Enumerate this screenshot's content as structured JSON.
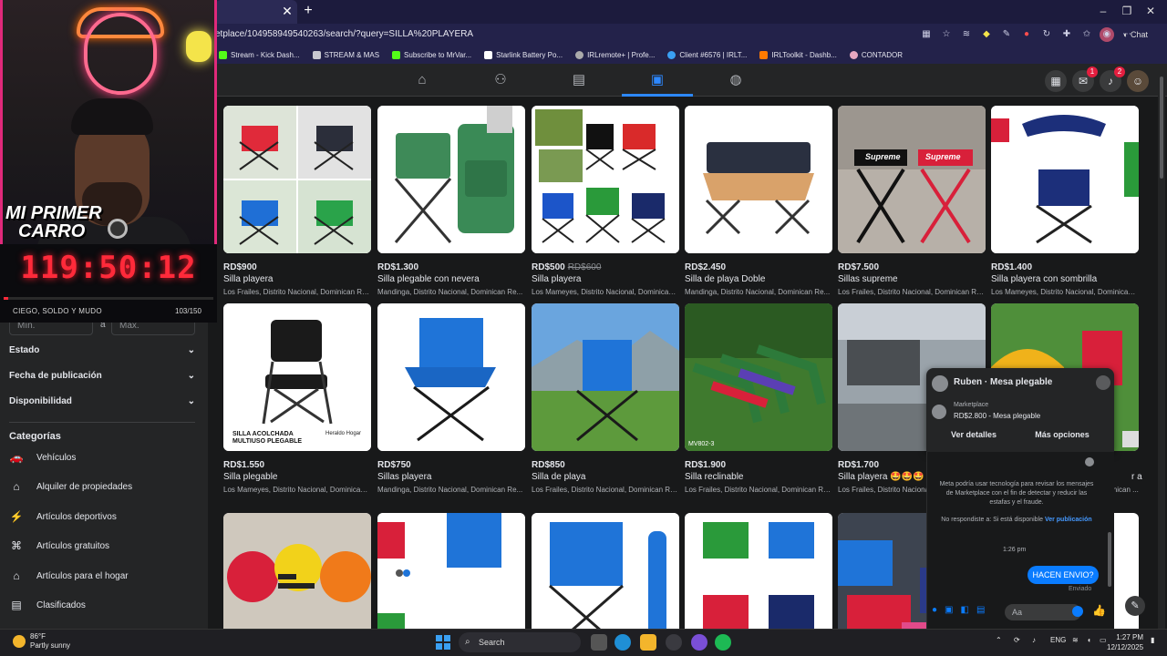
{
  "browser": {
    "url": "etplace/104958949540263/search/?query=SILLA%20PLAYERA",
    "bookmarks": [
      {
        "label": "Stream - Kick Dash..."
      },
      {
        "label": "STREAM & MAS"
      },
      {
        "label": "Subscribe to MrVar..."
      },
      {
        "label": "Starlink Battery Po..."
      },
      {
        "label": "IRLremote+ | Profe..."
      },
      {
        "label": "Client #6576 | IRLT..."
      },
      {
        "label": "IRLToolkit - Dashb..."
      },
      {
        "label": "CONTADOR"
      }
    ],
    "copilot_label": "Chat"
  },
  "facebook": {
    "badges": {
      "messenger": "1",
      "notifications": "2"
    }
  },
  "sidebar": {
    "min_placeholder": "Mín.",
    "max_placeholder": "Máx.",
    "range_sep": "a",
    "filters": [
      "Estado",
      "Fecha de publicación",
      "Disponibilidad"
    ],
    "categories_title": "Categorías",
    "categories": [
      {
        "label": "Vehículos",
        "icon": "car-icon"
      },
      {
        "label": "Alquiler de propiedades",
        "icon": "house-icon"
      },
      {
        "label": "Artículos deportivos",
        "icon": "running-icon"
      },
      {
        "label": "Artículos gratuitos",
        "icon": "tag-icon"
      },
      {
        "label": "Artículos para el hogar",
        "icon": "home-icon"
      },
      {
        "label": "Clasificados",
        "icon": "clipboard-icon"
      }
    ]
  },
  "stream_overlay": {
    "logo_line1": "MI PRIMER",
    "logo_line2": "CARRO",
    "timer": "119:50:12",
    "label": "CIEGO, SOLDO Y MUDO",
    "count": "103/150",
    "progress": 0.02
  },
  "listings": [
    {
      "price": "RD$900",
      "old_price": "",
      "title": "Silla playera",
      "location": "Los Frailes, Distrito Nacional, Dominican Re..."
    },
    {
      "price": "RD$1.300",
      "old_price": "",
      "title": "Silla plegable con nevera",
      "location": "Mandinga, Distrito Nacional, Dominican Re..."
    },
    {
      "price": "RD$500",
      "old_price": "RD$600",
      "title": "Silla playera",
      "location": "Los Mameyes, Distrito Nacional, Dominican ..."
    },
    {
      "price": "RD$2.450",
      "old_price": "",
      "title": "Silla de playa Doble",
      "location": "Mandinga, Distrito Nacional, Dominican Re..."
    },
    {
      "price": "RD$7.500",
      "old_price": "",
      "title": "Sillas supreme",
      "location": "Los Frailes, Distrito Nacional, Dominican Re..."
    },
    {
      "price": "RD$1.400",
      "old_price": "",
      "title": "Silla playera con sombrilla",
      "location": "Los Mameyes, Distrito Nacional, Dominican ..."
    },
    {
      "price": "RD$1.550",
      "old_price": "",
      "title": "Silla plegable",
      "location": "Los Mameyes, Distrito Nacional, Dominican ..."
    },
    {
      "price": "RD$750",
      "old_price": "",
      "title": "Sillas playera",
      "location": "Mandinga, Distrito Nacional, Dominican Re..."
    },
    {
      "price": "RD$850",
      "old_price": "",
      "title": "Silla de playa",
      "location": "Los Frailes, Distrito Nacional, Dominican Re..."
    },
    {
      "price": "RD$1.900",
      "old_price": "",
      "title": "Silla reclinable",
      "location": "Los Frailes, Distrito Nacional, Dominican Re..."
    },
    {
      "price": "RD$1.700",
      "old_price": "",
      "title": "Silla playera 🤩🤩🤩",
      "location": "Los Frailes, Distrito Nacional, Dominican Re..."
    },
    {
      "price": "",
      "old_price": "",
      "title": "r a",
      "location": "inican ..."
    }
  ],
  "image_texts": {
    "supreme": "Supreme",
    "acolchada_1": "SILLA ACOLCHADA",
    "acolchada_2": "MULTIUSO PLEGABLE",
    "heraldo": "Heraldo Hogar",
    "watermark": "MV802-3"
  },
  "chat": {
    "header_title": "Ruben · Mesa plegable",
    "source": "Marketplace",
    "item": "RD$2.800 - Mesa plegable",
    "btn_details": "Ver detalles",
    "btn_more": "Más opciones",
    "notice": "Meta podría usar tecnología para revisar los mensajes de Marketplace con el fin de detectar y reducir las estafas y el fraude.",
    "no_reply_prefix": "No respondiste a: Si está disponible",
    "no_reply_link": "Ver publicación",
    "time": "1:26 pm",
    "message": "HACEN ENVIO?",
    "status": "Enviado",
    "input_placeholder": "Aa"
  },
  "taskbar": {
    "temp": "86°F",
    "weather": "Partly sunny",
    "search_label": "Search",
    "lang": "ENG",
    "time": "1:27 PM",
    "date": "12/12/2025"
  },
  "colors": {
    "accent": "#2d88ff",
    "timer": "#ff2a3a",
    "chat_bubble": "#0a7cff",
    "bg": "#18191a"
  }
}
